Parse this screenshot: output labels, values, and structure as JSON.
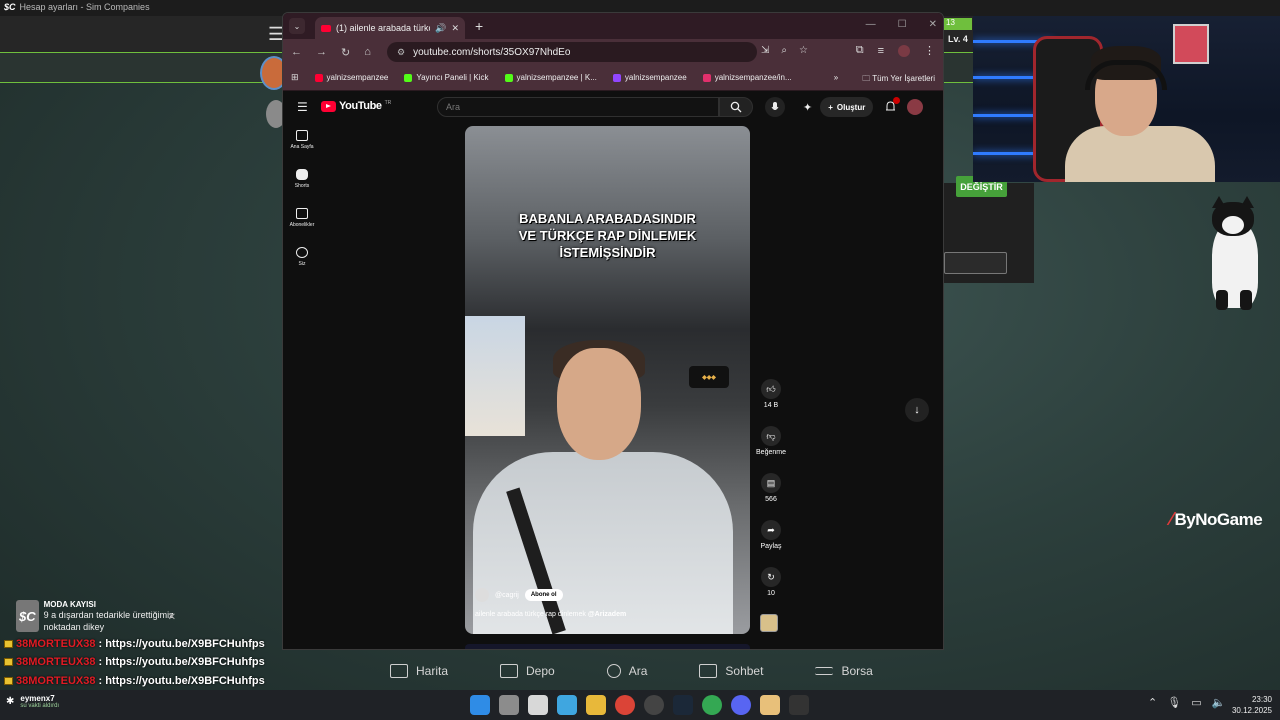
{
  "background_app": {
    "window_title": "Hesap ayarları - Sim Companies",
    "level_chip": "13",
    "level": "Lv. 4",
    "change_button": "DEĞİŞTİR",
    "sponsor": "ByNoGame",
    "mod_card": {
      "icon": "$C",
      "title": "MODA KAYISI",
      "text": "9 a dışardan tedarikle ürettiğimiz noktadan dikey"
    },
    "chat": [
      {
        "user": "38MORTEUX38",
        "message": ": https://youtu.be/X9BFCHuhfps"
      },
      {
        "user": "38MORTEUX38",
        "message": ": https://youtu.be/X9BFCHuhfps"
      },
      {
        "user": "38MORTEUX38",
        "message": ": https://youtu.be/X9BFCHuhfps"
      }
    ],
    "bottom_nav": [
      "Harita",
      "Depo",
      "Ara",
      "Sohbet",
      "Borsa"
    ]
  },
  "taskbar": {
    "user": "eymenx7",
    "status": "su vakti aldırdı",
    "time": "23:30",
    "date": "30.12.2025"
  },
  "browser": {
    "tab_title": "(1) ailenle arabada türkçe rap dinlemek",
    "url": "youtube.com/shorts/35OX97NhdEo",
    "bookmarks": [
      "yalnizsempanzee",
      "Yayıncı Paneli | Kick",
      "yalnizsempanzee | K...",
      "yalnizsempanzee",
      "yalnizsempanzee/in..."
    ],
    "all_bookmarks": "Tüm Yer İşaretleri"
  },
  "youtube": {
    "logo": "YouTube",
    "logo_country": "TR",
    "search_placeholder": "Ara",
    "create_label": "Oluştur",
    "sidebar": [
      "Ana Sayfa",
      "Shorts",
      "Abonelikler",
      "Siz"
    ],
    "short": {
      "caption": "BABANLA ARABADASINDIR\nVE TÜRKÇE RAP DİNLEMEK\nİSTEMİŞSİNDİR",
      "channel": "@cagrij",
      "subscribe": "Abone ol",
      "description": "ailenle arabada türkçe rap dinlemek",
      "mention": "@Arizadem"
    },
    "actions": [
      {
        "icon": "like-icon",
        "label": "14 B"
      },
      {
        "icon": "dislike-icon",
        "label": "Beğenme"
      },
      {
        "icon": "comment-icon",
        "label": "566"
      },
      {
        "icon": "share-icon",
        "label": "Paylaş"
      },
      {
        "icon": "remix-icon",
        "label": "10"
      }
    ]
  }
}
